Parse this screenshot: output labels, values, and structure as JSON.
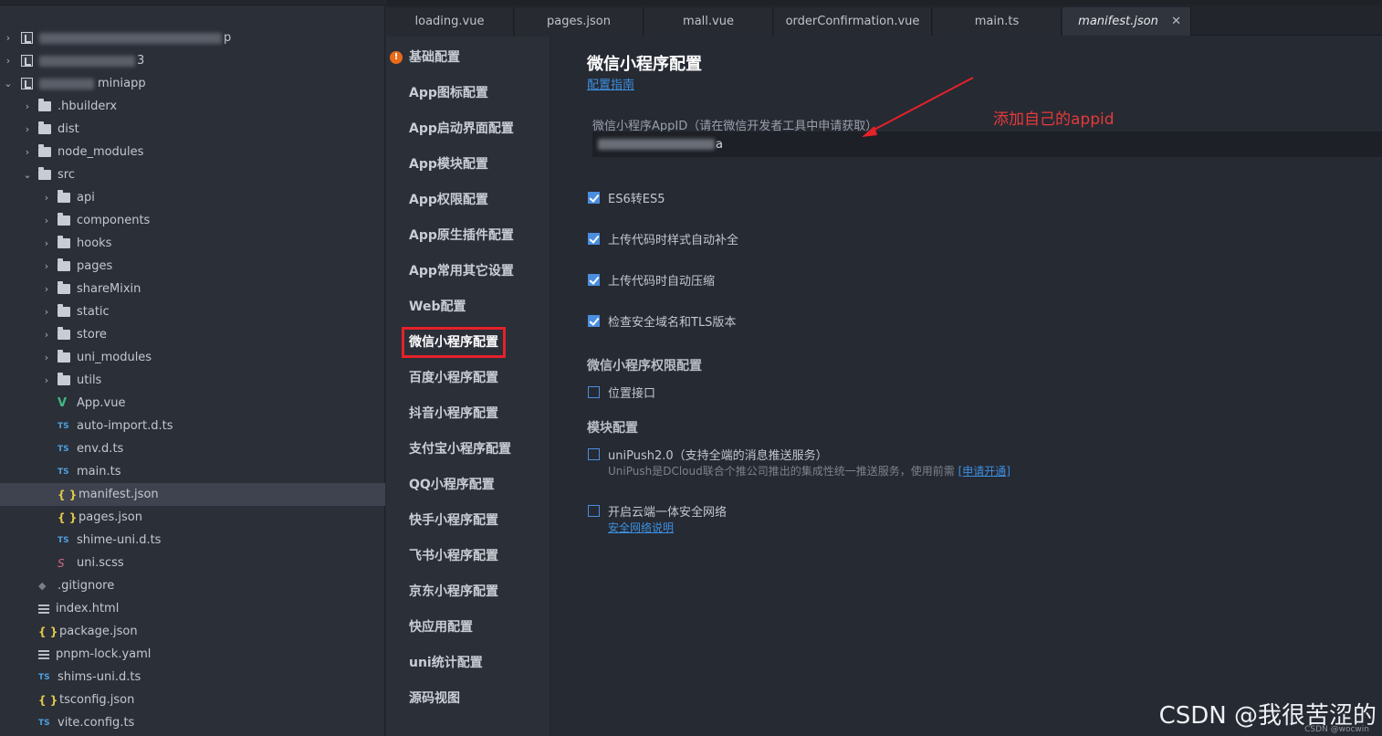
{
  "tabs": [
    {
      "label": "loading.vue",
      "active": false
    },
    {
      "label": "pages.json",
      "active": false
    },
    {
      "label": "mall.vue",
      "active": false
    },
    {
      "label": "orderConfirmation.vue",
      "active": false
    },
    {
      "label": "main.ts",
      "active": false
    },
    {
      "label": "manifest.json",
      "active": true
    }
  ],
  "tree": {
    "projects_blurred": [
      {
        "visible_suffix": "p"
      },
      {
        "visible_suffix": "3"
      },
      {
        "visible_suffix": "miniapp"
      }
    ],
    "items": [
      {
        "label": ".hbuilderx",
        "type": "folder"
      },
      {
        "label": "dist",
        "type": "folder"
      },
      {
        "label": "node_modules",
        "type": "folder"
      },
      {
        "label": "src",
        "type": "folder",
        "expanded": true
      },
      {
        "label": "api",
        "type": "folder"
      },
      {
        "label": "components",
        "type": "folder"
      },
      {
        "label": "hooks",
        "type": "folder"
      },
      {
        "label": "pages",
        "type": "folder"
      },
      {
        "label": "shareMixin",
        "type": "folder"
      },
      {
        "label": "static",
        "type": "folder"
      },
      {
        "label": "store",
        "type": "folder"
      },
      {
        "label": "uni_modules",
        "type": "folder"
      },
      {
        "label": "utils",
        "type": "folder"
      },
      {
        "label": "App.vue",
        "type": "vue"
      },
      {
        "label": "auto-import.d.ts",
        "type": "ts"
      },
      {
        "label": "env.d.ts",
        "type": "ts"
      },
      {
        "label": "main.ts",
        "type": "ts"
      },
      {
        "label": "manifest.json",
        "type": "json",
        "selected": true
      },
      {
        "label": "pages.json",
        "type": "json"
      },
      {
        "label": "shime-uni.d.ts",
        "type": "ts"
      },
      {
        "label": "uni.scss",
        "type": "scss"
      },
      {
        "label": ".gitignore",
        "type": "git"
      },
      {
        "label": "index.html",
        "type": "lines"
      },
      {
        "label": "package.json",
        "type": "json"
      },
      {
        "label": "pnpm-lock.yaml",
        "type": "lines"
      },
      {
        "label": "shims-uni.d.ts",
        "type": "ts"
      },
      {
        "label": "tsconfig.json",
        "type": "json"
      },
      {
        "label": "vite.config.ts",
        "type": "ts"
      }
    ]
  },
  "icons": {
    "ts": "TS",
    "json": "{ }",
    "vue": "V",
    "scss": "S",
    "git": "◆",
    "warn": "!",
    "close": "✕",
    "chevron_right": "›",
    "chevron_down": "⌄"
  },
  "settings_nav": [
    {
      "label": "基础配置",
      "warning": true
    },
    {
      "label": "App图标配置"
    },
    {
      "label": "App启动界面配置"
    },
    {
      "label": "App模块配置"
    },
    {
      "label": "App权限配置"
    },
    {
      "label": "App原生插件配置"
    },
    {
      "label": "App常用其它设置"
    },
    {
      "label": "Web配置"
    },
    {
      "label": "微信小程序配置",
      "active": true
    },
    {
      "label": "百度小程序配置"
    },
    {
      "label": "抖音小程序配置"
    },
    {
      "label": "支付宝小程序配置"
    },
    {
      "label": "QQ小程序配置"
    },
    {
      "label": "快手小程序配置"
    },
    {
      "label": "飞书小程序配置"
    },
    {
      "label": "京东小程序配置"
    },
    {
      "label": "快应用配置"
    },
    {
      "label": "uni统计配置"
    },
    {
      "label": "源码视图"
    }
  ],
  "content": {
    "title": "微信小程序配置",
    "guide_link": "配置指南",
    "appid_label": "微信小程序AppID（请在微信开发者工具中申请获取）",
    "appid_value_suffix": "a",
    "options": [
      {
        "label": "ES6转ES5",
        "checked": true
      },
      {
        "label": "上传代码时样式自动补全",
        "checked": true
      },
      {
        "label": "上传代码时自动压缩",
        "checked": true
      },
      {
        "label": "检查安全域名和TLS版本",
        "checked": true
      }
    ],
    "permission_section": "微信小程序权限配置",
    "permission_option": {
      "label": "位置接口",
      "checked": false
    },
    "module_section": "模块配置",
    "unipush": {
      "label": "uniPush2.0（支持全端的消息推送服务）",
      "checked": false,
      "note": "UniPush是DCloud联合个推公司推出的集成性统一推送服务，使用前需",
      "note_link": "[申请开通]"
    },
    "secure_network": {
      "label": "开启云端一体安全网络",
      "checked": false,
      "link": "安全网络说明"
    }
  },
  "annotation": {
    "text": "添加自己的appid",
    "color": "#e53a3a"
  },
  "watermark": {
    "text": "CSDN @我很苦涩的",
    "small": "CSDN @wocwin"
  },
  "colors": {
    "accent": "#4a8ee0",
    "highlight_border": "#e5212a",
    "warning": "#e86b1a",
    "link": "#3d8fe0"
  }
}
